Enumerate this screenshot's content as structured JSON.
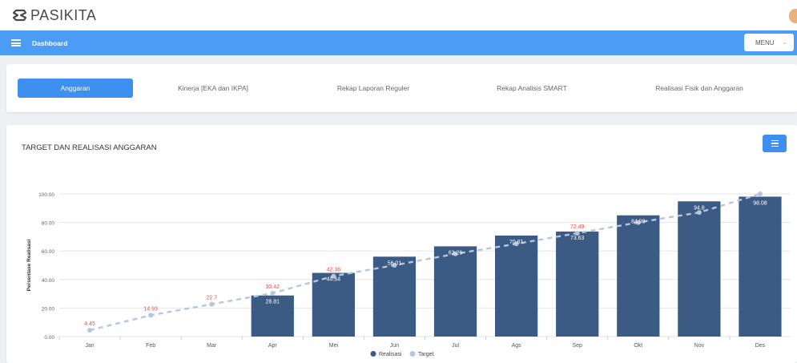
{
  "app": {
    "name": "PASIKITA"
  },
  "navbar": {
    "title": "Dashboard",
    "menu_label": "MENU"
  },
  "tabs": [
    {
      "label": "Anggaran",
      "active": true
    },
    {
      "label": "Kinerja [EKA dan IKPA]",
      "active": false
    },
    {
      "label": "Rekap Laporan Reguler",
      "active": false
    },
    {
      "label": "Rekap Analisis SMART",
      "active": false
    },
    {
      "label": "Realisasi Fisik dan Anggaran",
      "active": false
    }
  ],
  "colors": {
    "accent": "#4b9cf5",
    "realisasi": "#3b5b84",
    "target": "#b4c6e2",
    "target_label": "#e05252"
  },
  "chart_data": {
    "type": "bar",
    "title": "TARGET DAN REALISASI ANGGARAN",
    "ylabel": "Persentase Realisasi",
    "xlabel": "",
    "ylim": [
      0,
      100
    ],
    "yticks": [
      "0.00",
      "20.00",
      "40.00",
      "60.00",
      "80.00",
      "100.00"
    ],
    "categories": [
      "Jan",
      "Feb",
      "Mar",
      "Apr",
      "Mei",
      "Jun",
      "Jul",
      "Ags",
      "Sep",
      "Okt",
      "Nov",
      "Des"
    ],
    "series": [
      {
        "name": "Realisasi",
        "type": "bar",
        "values": [
          null,
          null,
          null,
          28.81,
          44.64,
          56.01,
          63.26,
          70.81,
          73.63,
          84.99,
          94.8,
          98.08
        ],
        "labels": [
          "",
          "",
          "",
          "28.81",
          "44.64",
          "56.01",
          "63.26",
          "70.81",
          "73.63",
          "84.99",
          "94.8",
          "98.08"
        ]
      },
      {
        "name": "Target",
        "type": "line",
        "values": [
          4.45,
          14.93,
          22.7,
          30.42,
          42.36,
          50.0,
          58.0,
          65.0,
          72.49,
          80.0,
          87.0,
          100.0
        ],
        "labels": [
          "4.45",
          "14.93",
          "22.7",
          "30.42",
          "42.36",
          "",
          "",
          "",
          "72.49",
          "",
          "",
          ""
        ]
      }
    ],
    "legend": [
      "Realisasi",
      "Target"
    ],
    "legend_position": "bottom",
    "grid": true
  }
}
